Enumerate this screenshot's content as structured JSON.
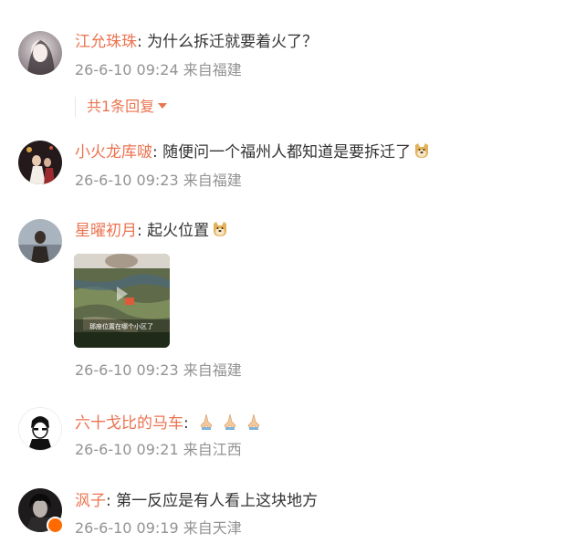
{
  "comments": [
    {
      "username": "江允珠珠",
      "separator": ":",
      "text": " 为什么拆迁就要着火了？",
      "time": "26-6-10 09:24",
      "location": "来自福建",
      "replies_label": "共1条回复"
    },
    {
      "username": "小火龙库啵",
      "separator": ":",
      "text": " 随便问一个福州人都知道是要拆迁了",
      "time": "26-6-10 09:23",
      "location": "来自福建"
    },
    {
      "username": "星曜初月",
      "separator": ":",
      "text": " 起火位置",
      "time": "26-6-10 09:23",
      "location": "来自福建",
      "image_caption": "那座位置在哪个小区了"
    },
    {
      "username": "六十戈比的马车",
      "separator": ":",
      "text": " ",
      "time": "26-6-10 09:21",
      "location": "来自江西",
      "emojis": [
        "praying-hands",
        "praying-hands",
        "praying-hands"
      ]
    },
    {
      "username": "沨子",
      "separator": ":",
      "text": " 第一反应是有人看上这块地方",
      "time": "26-6-10 09:19",
      "location": "来自天津"
    }
  ],
  "colors": {
    "username": "#eb7350",
    "text": "#333333",
    "meta": "#939393"
  }
}
